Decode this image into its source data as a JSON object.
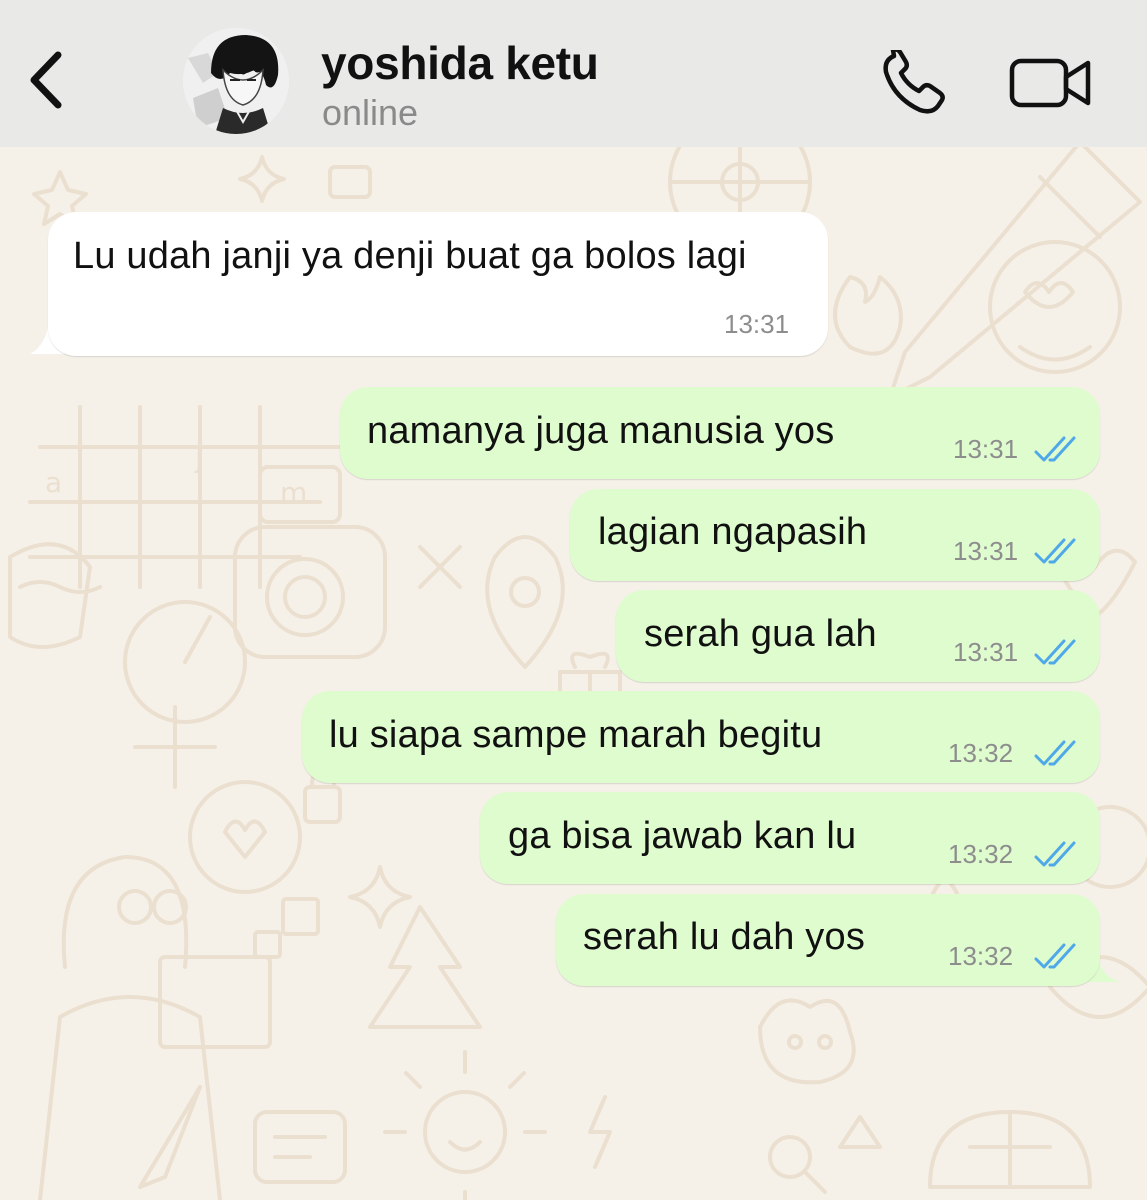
{
  "header": {
    "contact_name": "yoshida ketu",
    "status": "online",
    "back_icon": "chevron-left-icon",
    "call_icon": "phone-icon",
    "video_icon": "video-camera-icon"
  },
  "messages": [
    {
      "direction": "incoming",
      "text": "Lu udah janji ya denji buat ga bolos lagi",
      "time": "13:31"
    },
    {
      "direction": "outgoing",
      "text": "namanya juga manusia yos",
      "time": "13:31",
      "status": "read"
    },
    {
      "direction": "outgoing",
      "text": "lagian ngapasih",
      "time": "13:31",
      "status": "read"
    },
    {
      "direction": "outgoing",
      "text": "serah gua lah",
      "time": "13:31",
      "status": "read"
    },
    {
      "direction": "outgoing",
      "text": "lu siapa sampe marah begitu",
      "time": "13:32",
      "status": "read"
    },
    {
      "direction": "outgoing",
      "text": "ga bisa jawab kan lu",
      "time": "13:32",
      "status": "read"
    },
    {
      "direction": "outgoing",
      "text": "serah lu dah yos",
      "time": "13:32",
      "status": "read"
    }
  ],
  "colors": {
    "header_bg": "#e9e9e7",
    "chat_bg": "#f5f1e9",
    "incoming_bubble": "#ffffff",
    "outgoing_bubble": "#dffccf",
    "read_tick": "#4fa8e8",
    "timestamp": "#8d8d8d"
  }
}
